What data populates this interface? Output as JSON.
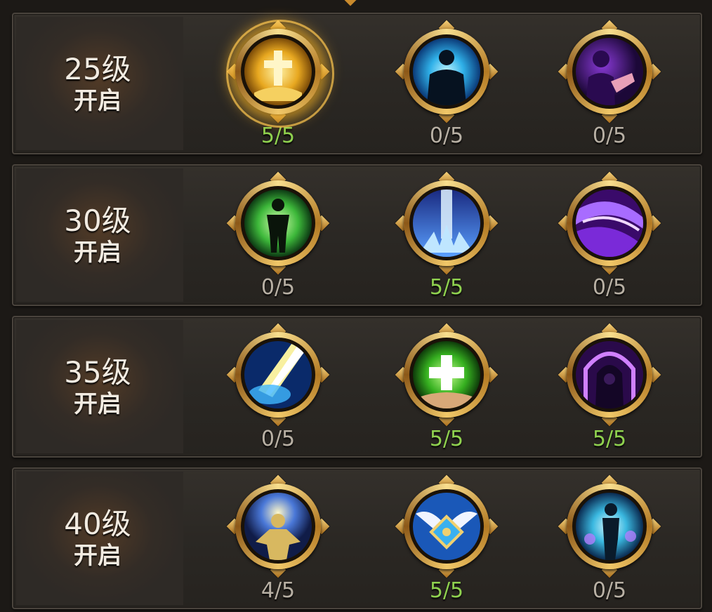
{
  "colors": {
    "maxed": "#8fd14f",
    "normal": "#b8b0a4",
    "frame_gold": "#f0c768"
  },
  "tiers": [
    {
      "level": "25级",
      "unlock": "开启",
      "skills": [
        {
          "icon": "golden-cross-icon",
          "count": "5/5",
          "maxed": true
        },
        {
          "icon": "shadow-figure-blue-icon",
          "count": "0/5",
          "maxed": false
        },
        {
          "icon": "purple-hand-icon",
          "count": "0/5",
          "maxed": false
        }
      ]
    },
    {
      "level": "30级",
      "unlock": "开启",
      "skills": [
        {
          "icon": "green-aura-figure-icon",
          "count": "0/5",
          "maxed": false
        },
        {
          "icon": "blue-light-burst-icon",
          "count": "5/5",
          "maxed": true
        },
        {
          "icon": "purple-swirl-icon",
          "count": "0/5",
          "maxed": false
        }
      ]
    },
    {
      "level": "35级",
      "unlock": "开启",
      "skills": [
        {
          "icon": "blue-comet-icon",
          "count": "0/5",
          "maxed": false
        },
        {
          "icon": "green-heal-cross-icon",
          "count": "5/5",
          "maxed": true
        },
        {
          "icon": "hooded-mage-icon",
          "count": "5/5",
          "maxed": true
        }
      ]
    },
    {
      "level": "40级",
      "unlock": "开启",
      "skills": [
        {
          "icon": "golden-warrior-icon",
          "count": "4/5",
          "maxed": false
        },
        {
          "icon": "winged-shield-icon",
          "count": "5/5",
          "maxed": true
        },
        {
          "icon": "blue-energy-figure-icon",
          "count": "0/5",
          "maxed": false
        }
      ]
    }
  ]
}
